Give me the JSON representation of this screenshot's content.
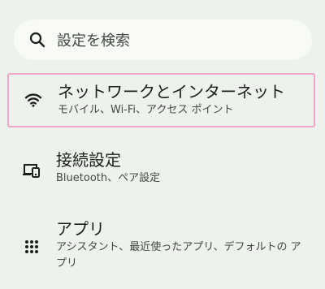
{
  "search": {
    "placeholder": "設定を検索",
    "icon": "search-icon"
  },
  "settings": [
    {
      "title": "ネットワークとインターネット",
      "subtitle": "モバイル、Wi-Fi、アクセス ポイント",
      "icon": "wifi-icon",
      "selected": true
    },
    {
      "title": "接続設定",
      "subtitle": "Bluetooth、ペア設定",
      "icon": "devices-icon",
      "selected": false
    },
    {
      "title": "アプリ",
      "subtitle": "アシスタント、最近使ったアプリ、デフォルトの アプリ",
      "icon": "apps-grid-icon",
      "selected": false
    }
  ],
  "colors": {
    "background": "#eef2ec",
    "highlight_border": "#f0a6c8"
  }
}
